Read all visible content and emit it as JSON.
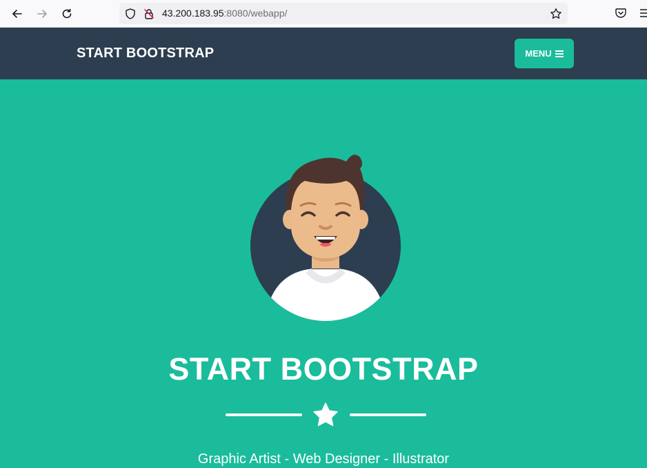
{
  "browser": {
    "url_host": "43.200.183.95",
    "url_rest": ":8080/webapp/"
  },
  "navbar": {
    "brand": "START BOOTSTRAP",
    "menu_label": "MENU"
  },
  "masthead": {
    "title": "START BOOTSTRAP",
    "subtitle": "Graphic Artist - Web Designer - Illustrator"
  },
  "colors": {
    "primary": "#1abc9c",
    "navbar": "#2c3e50",
    "text_light": "#ffffff"
  }
}
